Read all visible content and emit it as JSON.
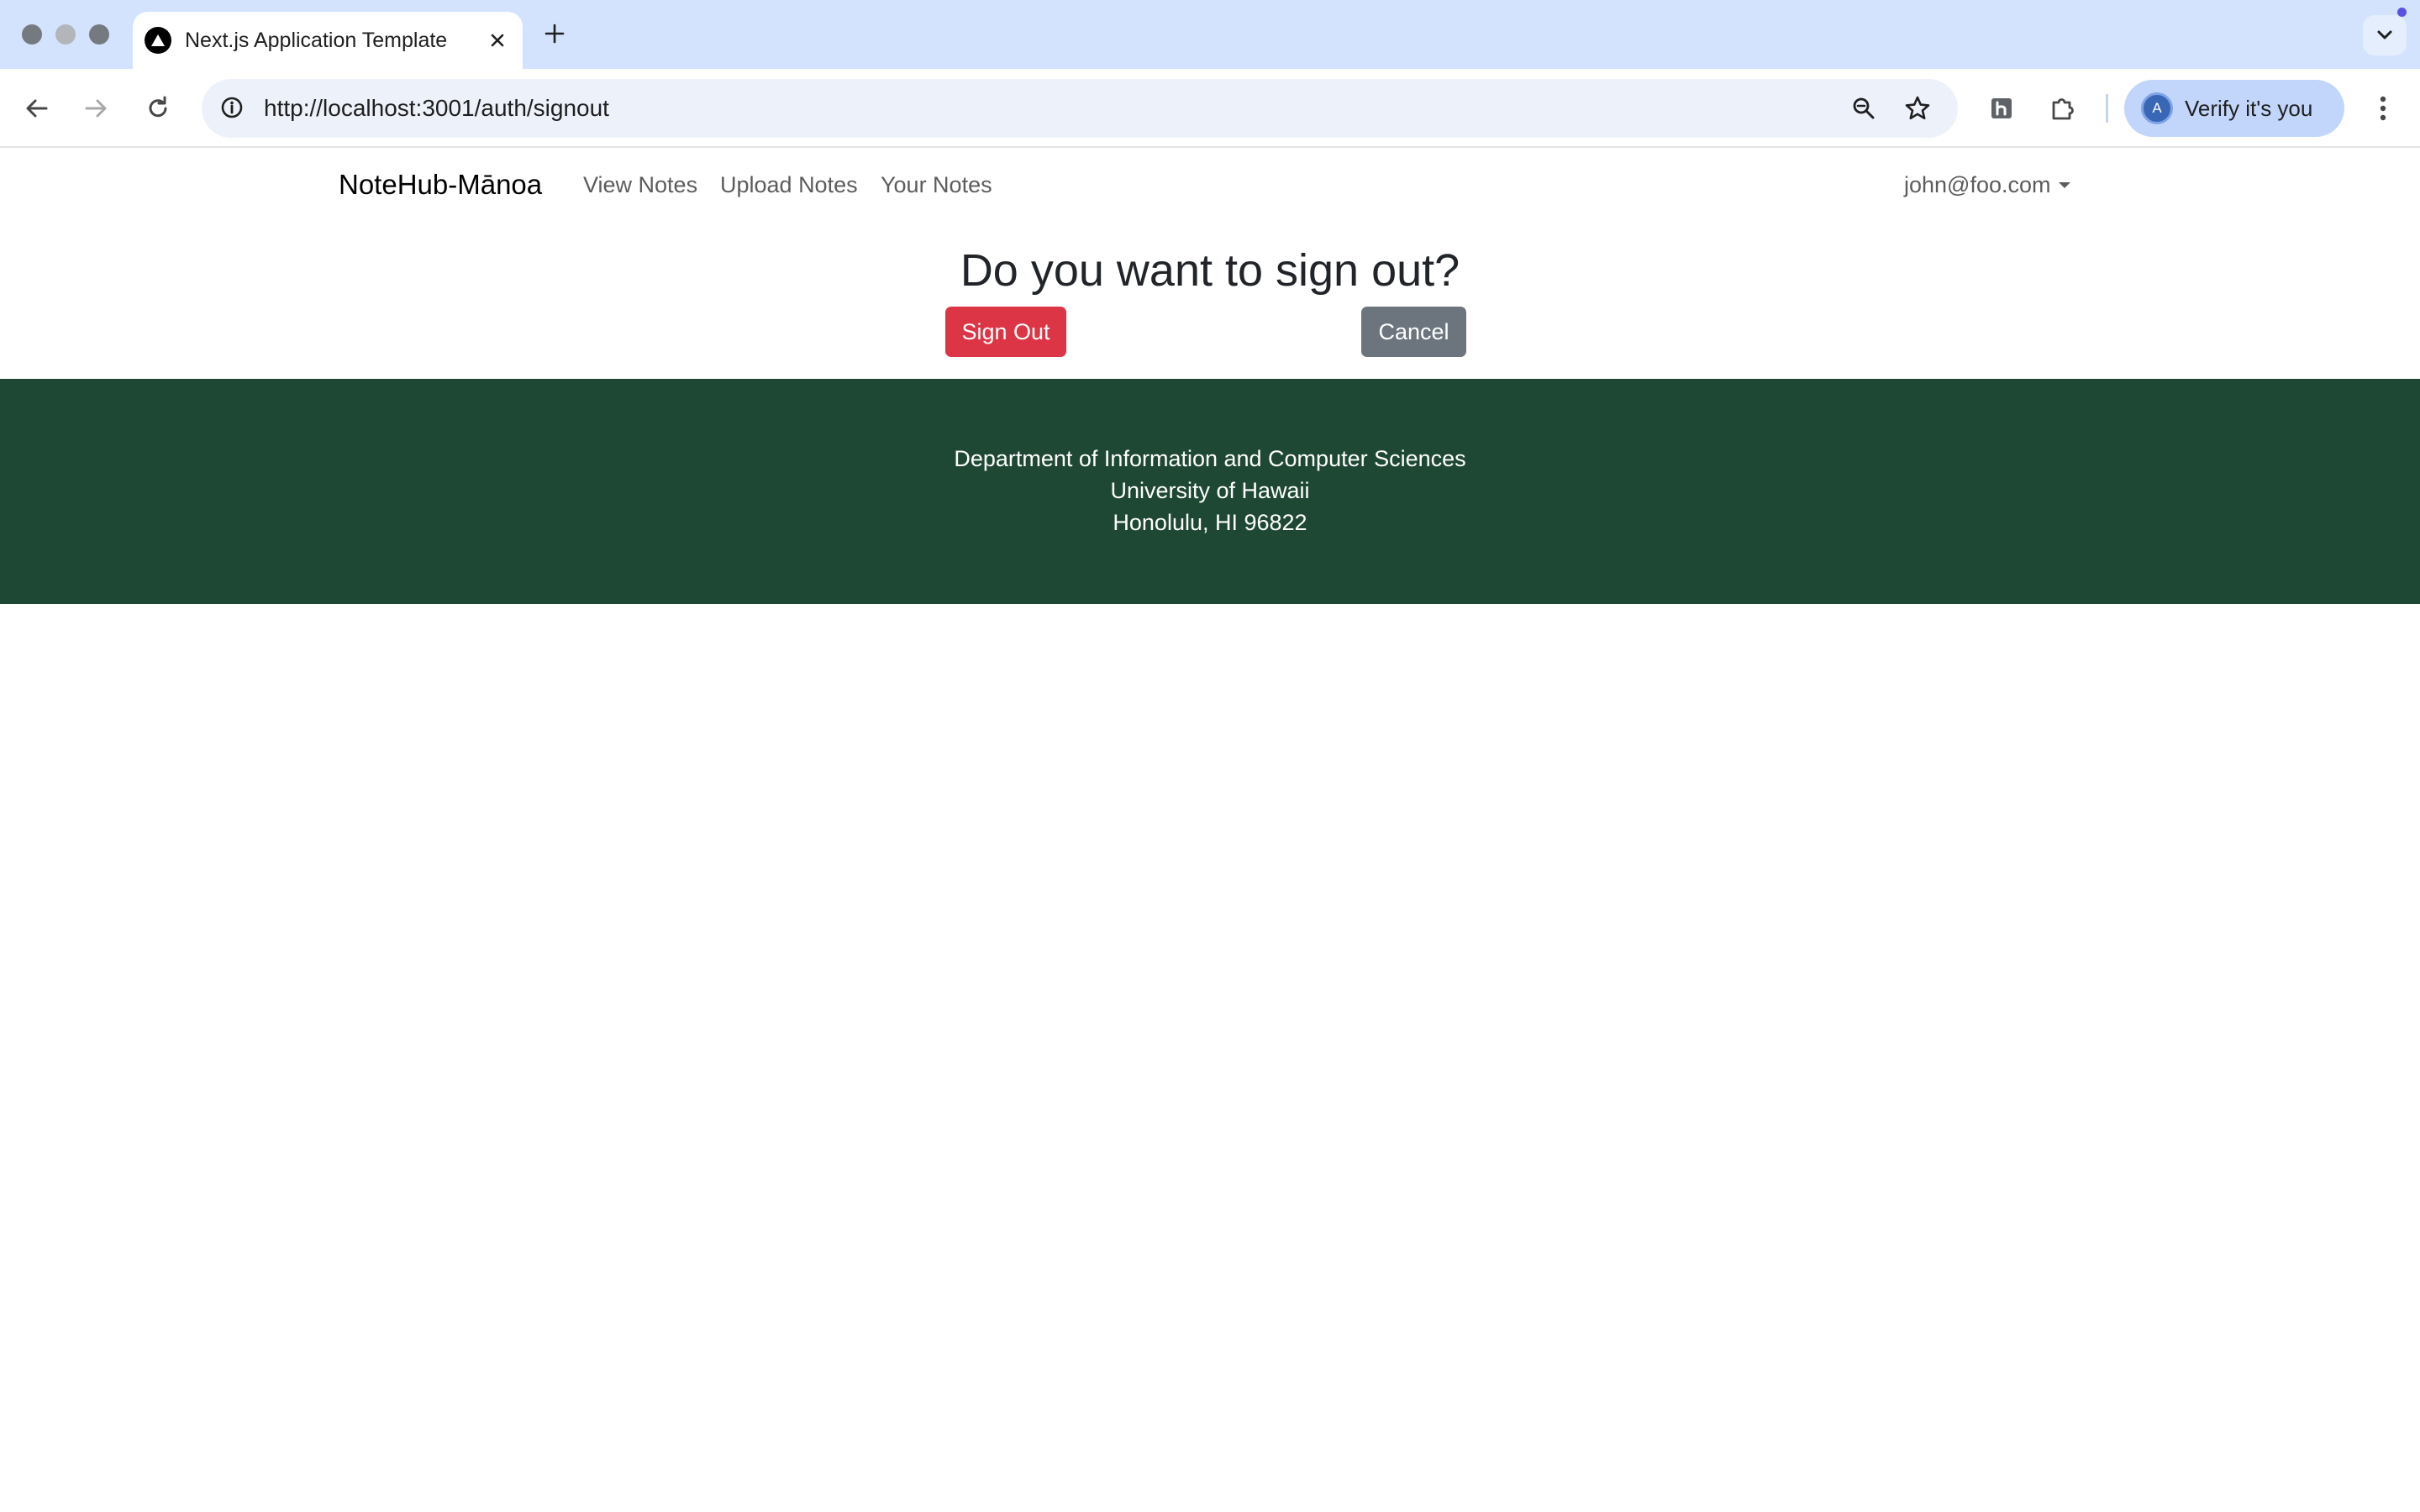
{
  "browser": {
    "tab": {
      "title": "Next.js Application Template"
    },
    "address_bar": {
      "url": "http://localhost:3001/auth/signout"
    },
    "profile": {
      "label": "Verify it's you",
      "avatar_letter": "A"
    },
    "icons": {
      "back": "arrow-left-icon",
      "forward": "arrow-right-icon",
      "reload": "reload-icon",
      "site_info": "info-icon",
      "zoom": "zoom-icon",
      "bookmark": "star-icon",
      "extension_h": "h-extension-icon",
      "extensions": "puzzle-icon",
      "menu": "kebab-menu-icon",
      "new_tab": "plus-icon",
      "tab_search": "chevron-down-icon"
    }
  },
  "navbar": {
    "brand": "NoteHub-Mānoa",
    "links": [
      {
        "label": "View Notes"
      },
      {
        "label": "Upload Notes"
      },
      {
        "label": "Your Notes"
      }
    ],
    "user": "john@foo.com"
  },
  "signout": {
    "heading": "Do you want to sign out?",
    "sign_out_label": "Sign Out",
    "cancel_label": "Cancel"
  },
  "footer": {
    "lines": [
      "Department of Information and Computer Sciences",
      "University of Hawaii",
      "Honolulu, HI 96822"
    ]
  },
  "colors": {
    "chrome_tab_strip": "#d3e3fd",
    "omnibox": "#edf1fa",
    "danger": "#dc3545",
    "secondary": "#6c757d",
    "footer_bg": "#1e4834",
    "heading_text": "#212529"
  }
}
